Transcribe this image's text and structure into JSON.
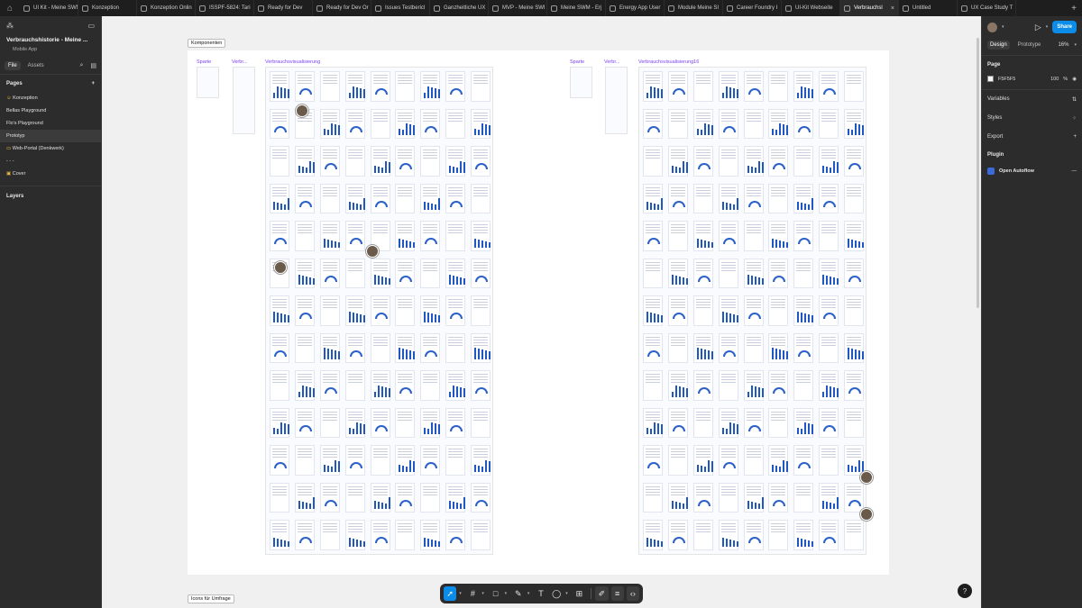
{
  "tabs": [
    {
      "label": "UI Kit - Meine SWM",
      "active": false
    },
    {
      "label": "Konzeption",
      "active": false
    },
    {
      "label": "Konzeption Onlin",
      "active": false
    },
    {
      "label": "ISSPF-5824: Tari",
      "active": false
    },
    {
      "label": "Ready for Dev",
      "active": false
    },
    {
      "label": "Ready for Dev Or",
      "active": false
    },
    {
      "label": "Issues Testbericl",
      "active": false
    },
    {
      "label": "Ganzheitliche UX",
      "active": false
    },
    {
      "label": "MVP - Meine SWI",
      "active": false
    },
    {
      "label": "Meine SWM - Erj",
      "active": false
    },
    {
      "label": "Energy App User",
      "active": false
    },
    {
      "label": "Module Meine SI",
      "active": false
    },
    {
      "label": "Career Foundry I",
      "active": false
    },
    {
      "label": "UI-Kit Webseite",
      "active": false
    },
    {
      "label": "Verbrauchsl",
      "active": true
    },
    {
      "label": "Untitled",
      "active": false
    },
    {
      "label": "UX Case Study T",
      "active": false
    }
  ],
  "file": {
    "title": "Verbrauchshistorie - Meine ...",
    "subtitle": "Mobile App",
    "tab_file": "File",
    "tab_assets": "Assets"
  },
  "pages": {
    "heading": "Pages",
    "items": [
      {
        "label": "Konzeption",
        "icon": "emoji-icon"
      },
      {
        "label": "Bellas Playground",
        "icon": ""
      },
      {
        "label": "Flo's Playground",
        "icon": ""
      },
      {
        "label": "Prototyp",
        "icon": "",
        "selected": true
      },
      {
        "label": "Web-Portal (Denkwerk)",
        "icon": "monitor-icon"
      },
      {
        "label": "- - -",
        "icon": ""
      },
      {
        "label": "Cover",
        "icon": "folder-icon"
      }
    ]
  },
  "layers": {
    "heading": "Layers"
  },
  "canvas": {
    "frame_top": "Komponenten",
    "frame_bottom": "Icons für Umfrage",
    "components": [
      "Sparte",
      "Verbr...",
      "Verbrauchsvisualisierung",
      "Sparte",
      "Verbr...",
      "Verbrauchsvisualisierung16"
    ]
  },
  "right": {
    "share": "Share",
    "tab_design": "Design",
    "tab_prototype": "Prototype",
    "zoom": "16%",
    "page_heading": "Page",
    "page_color": "F5F5F5",
    "page_opacity": "100",
    "page_pct": "%",
    "variables": "Variables",
    "styles": "Styles",
    "export": "Export",
    "plugin_heading": "Plugin",
    "plugin_name": "Open Autoflow"
  },
  "help": "?"
}
